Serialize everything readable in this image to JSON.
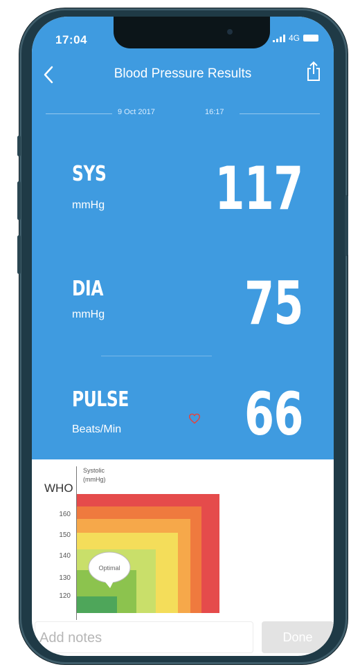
{
  "status_bar": {
    "time": "17:04",
    "network": "4G"
  },
  "header": {
    "title": "Blood Pressure Results"
  },
  "reading": {
    "date": "9 Oct 2017",
    "time": "16:17"
  },
  "metrics": {
    "sys": {
      "label": "SYS",
      "unit": "mmHg",
      "value": "117"
    },
    "dia": {
      "label": "DIA",
      "unit": "mmHg",
      "value": "75"
    },
    "pulse": {
      "label": "PULSE",
      "unit": "Beats/Min",
      "value": "66"
    }
  },
  "who_chart": {
    "title": "WHO",
    "axis_label_line1": "Systolic",
    "axis_label_line2": "(mmHg)",
    "ticks": [
      "160",
      "150",
      "140",
      "130",
      "120"
    ],
    "callout": "Optimal",
    "zone_colors": [
      "#e54b4b",
      "#ef7a3e",
      "#f6a84a",
      "#f4dd5a",
      "#c9df6a",
      "#8cc34e",
      "#4ea65a"
    ]
  },
  "footer": {
    "notes_placeholder": "Add notes",
    "done_label": "Done"
  },
  "colors": {
    "accent": "#3f9be0",
    "heart": "#e8413a"
  }
}
